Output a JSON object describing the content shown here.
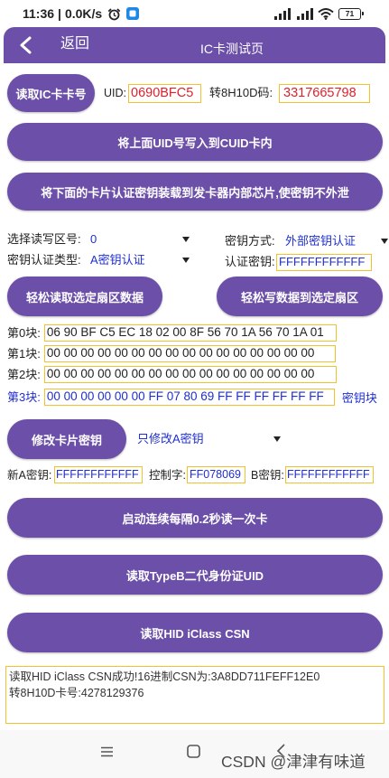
{
  "status_bar": {
    "time": "11:36",
    "separator": "|",
    "net_speed": "0.0K/s",
    "battery": "71"
  },
  "header": {
    "back_label": "返回",
    "title": "IC卡测试页"
  },
  "uid_section": {
    "read_button": "读取IC卡卡号",
    "uid_label": "UID:",
    "uid_value": "0690BFC5",
    "h10d_label": "转8H10D码:",
    "h10d_value": "3317665798"
  },
  "actions": {
    "write_cuid": "将上面UID号写入到CUID卡内",
    "load_key": "将下面的卡片认证密钥装载到发卡器内部芯片,使密钥不外泄"
  },
  "settings": {
    "sector_label": "选择读写区号:",
    "sector_value": "0",
    "key_mode_label": "密钥方式:",
    "key_mode_value": "外部密钥认证",
    "auth_type_label": "密钥认证类型:",
    "auth_type_value": "A密钥认证",
    "auth_key_label": "认证密钥:",
    "auth_key_value": "FFFFFFFFFFFF"
  },
  "sector_buttons": {
    "read": "轻松读取选定扇区数据",
    "write": "轻松写数据到选定扇区"
  },
  "blocks": [
    {
      "label": "第0块:",
      "data": "06 90 BF C5 EC 18 02 00 8F 56 70 1A 56 70 1A 01"
    },
    {
      "label": "第1块:",
      "data": "00 00 00 00 00 00 00 00 00 00 00 00 00 00 00 00"
    },
    {
      "label": "第2块:",
      "data": "00 00 00 00 00 00 00 00 00 00 00 00 00 00 00 00"
    },
    {
      "label": "第3块:",
      "data": "00 00 00 00 00 00 FF 07 80 69 FF FF FF FF FF FF",
      "note": "密钥块"
    }
  ],
  "key_change": {
    "button": "修改卡片密钥",
    "mode_value": "只修改A密钥",
    "new_a_label": "新A密钥:",
    "new_a_value": "FFFFFFFFFFFF",
    "control_label": "控制字:",
    "control_value": "FF078069",
    "b_key_label": "B密钥:",
    "b_key_value": "FFFFFFFFFFFF"
  },
  "bottom_actions": {
    "continuous_read": "启动连续每隔0.2秒读一次卡",
    "read_typeb": "读取TypeB二代身份证UID",
    "read_hid": "读取HID iClass CSN"
  },
  "log": {
    "lines": [
      "读取HID iClass CSN成功!16进制CSN为:3A8DD711FEFF12E0",
      "转8H10D卡号:4278129376"
    ]
  },
  "watermark": "CSDN @津津有味道",
  "icons": {
    "status_bar": [
      "alarm-icon",
      "app-icon",
      "signal-icon",
      "signal-icon",
      "wifi-icon",
      "battery-icon"
    ],
    "header": [
      "chevron-left-icon"
    ],
    "dropdowns": [
      "dropdown-arrow-icon"
    ],
    "nav_bar": [
      "menu-icon",
      "home-icon",
      "back-icon"
    ]
  },
  "colors": {
    "primary": "#6b4fa8",
    "accent_blue": "#1f2fd0",
    "value_red": "#e0202a",
    "field_border": "#f2c12e"
  }
}
